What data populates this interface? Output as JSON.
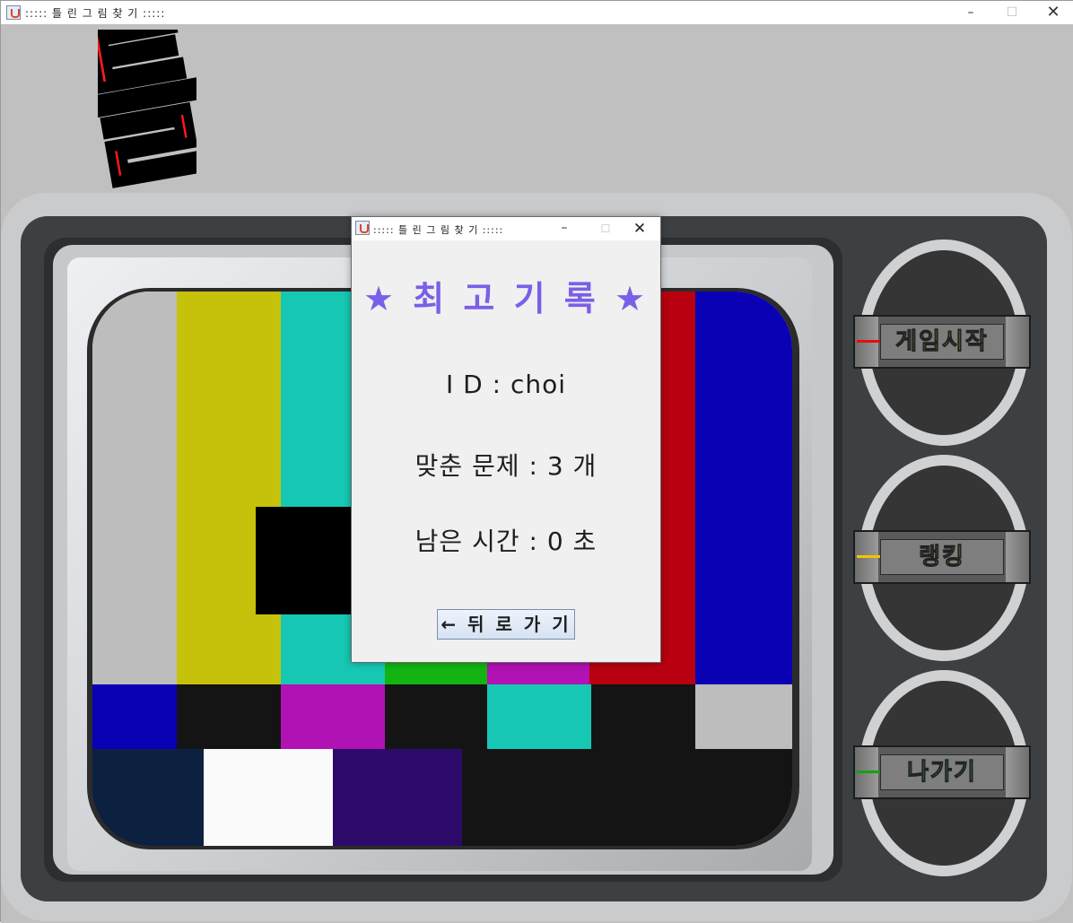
{
  "window": {
    "title": "::::: 틀 린 그 림 찾 기 :::::",
    "app_icon": "java-cup-icon",
    "controls": {
      "minimize": "–",
      "maximize": "☐",
      "close": "✕"
    }
  },
  "logo": {
    "text": "틀",
    "fill": "#ff1a1a",
    "outline": "#000000"
  },
  "menu": {
    "buttons": [
      {
        "label": "게임시작",
        "color": "#c8f000",
        "tick_color": "#e01010"
      },
      {
        "label": "랭킹",
        "color": "#ffd400",
        "tick_color": "#f2c400"
      },
      {
        "label": "나가기",
        "color": "#18e6ff",
        "tick_color": "#14a014"
      }
    ]
  },
  "dialog": {
    "title": "::::: 틀 린 그 림 찾 기 :::::",
    "controls": {
      "minimize": "–",
      "maximize": "☐",
      "close": "✕"
    },
    "heading": "★ 최 고 기 록 ★",
    "id_line": "I D  :  choi",
    "correct_line": "맞춘 문제  :  3 개",
    "time_line": "남은 시간  :  0 초",
    "back_button": "← 뒤 로 가 기"
  },
  "colors": {
    "accent": "#7b5fe8",
    "test_bars": [
      "#bdbdbd",
      "#c6c20c",
      "#16c8b4",
      "#12b412",
      "#b012b4",
      "#b80010",
      "#0a00b4"
    ]
  }
}
